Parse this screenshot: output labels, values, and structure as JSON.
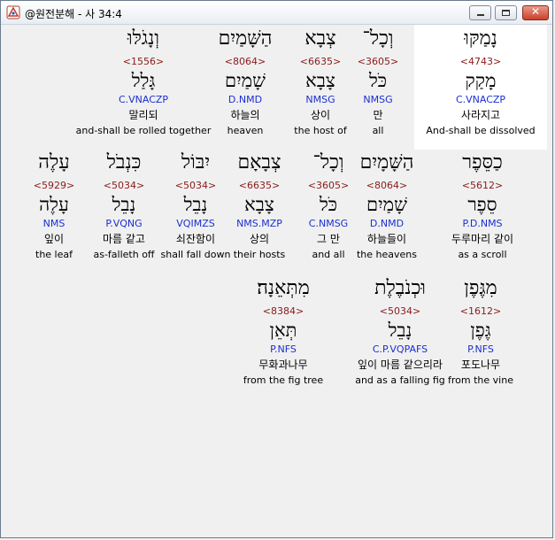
{
  "window": {
    "title": "@원전분해 - 사 34:4"
  },
  "rows": [
    [
      {
        "heb": "נָמַקּוּ",
        "num": "<4743>",
        "lemma": "מָקַק",
        "parse": "C.VNACZP",
        "kor": "사라지고",
        "eng": "And-shall be dissolved",
        "highlighted": true
      },
      {
        "heb": "וְכָל־",
        "num": "<3605>",
        "lemma": "כֹּל",
        "parse": "NMSG",
        "kor": "만",
        "eng": "all"
      },
      {
        "heb": "צְבָא",
        "num": "<6635>",
        "lemma": "צָבָא",
        "parse": "NMSG",
        "kor": "상이",
        "eng": "the host of"
      },
      {
        "heb": "הַשָּׁמַיִם",
        "num": "<8064>",
        "lemma": "שָׁמַיִם",
        "parse": "D.NMD",
        "kor": "하늘의",
        "eng": "heaven"
      },
      {
        "heb": "וְנָגֹלּוּ",
        "num": "<1556>",
        "lemma": "גָּלַל",
        "parse": "C.VNACZP",
        "kor": "말리되",
        "eng": "and-shall be rolled together"
      }
    ],
    [
      {
        "heb": "כַסֵּפֶר",
        "num": "<5612>",
        "lemma": "סֵפֶר",
        "parse": "P.D.NMS",
        "kor": "두루마리 같이",
        "eng": "as a scroll"
      },
      {
        "heb": "הַשָּׁמָיִם",
        "num": "<8064>",
        "lemma": "שָׁמַיִם",
        "parse": "D.NMD",
        "kor": "하늘들이",
        "eng": "the heavens"
      },
      {
        "heb": "וְכָל־",
        "num": "<3605>",
        "lemma": "כֹּל",
        "parse": "C.NMSG",
        "kor": "그 만",
        "eng": "and all"
      },
      {
        "heb": "צְבָאָם",
        "num": "<6635>",
        "lemma": "צָבָא",
        "parse": "NMS.MZP",
        "kor": "상의",
        "eng": "their hosts"
      },
      {
        "heb": "יִבּוֹל",
        "num": "<5034>",
        "lemma": "נָבֵל",
        "parse": "VQIMZS",
        "kor": "쇠잔함이",
        "eng": "shall fall down"
      },
      {
        "heb": "כִּנְבֹל",
        "num": "<5034>",
        "lemma": "נָבֵל",
        "parse": "P.VQNG",
        "kor": "마름 같고",
        "eng": "as-falleth off"
      },
      {
        "heb": "עָלֶה",
        "num": "<5929>",
        "lemma": "עָלֶה",
        "parse": "NMS",
        "kor": "잎이",
        "eng": "the leaf"
      }
    ],
    [
      {
        "heb": "מִגֶּפֶן",
        "num": "<1612>",
        "lemma": "גֶּפֶן",
        "parse": "P.NFS",
        "kor": "포도나무",
        "eng": "from the vine"
      },
      {
        "heb": "וּכְנֹבֶלֶת",
        "num": "<5034>",
        "lemma": "נָבֵל",
        "parse": "C.P.VQPAFS",
        "kor": "잎이 마름 같으리라",
        "eng": "and as a falling fig"
      },
      {
        "heb": "מִתְּאֵנָה׃",
        "num": "<8384>",
        "lemma": "תְּאֵן",
        "parse": "P.NFS",
        "kor": "무화과나무",
        "eng": "from the fig tree"
      }
    ]
  ]
}
